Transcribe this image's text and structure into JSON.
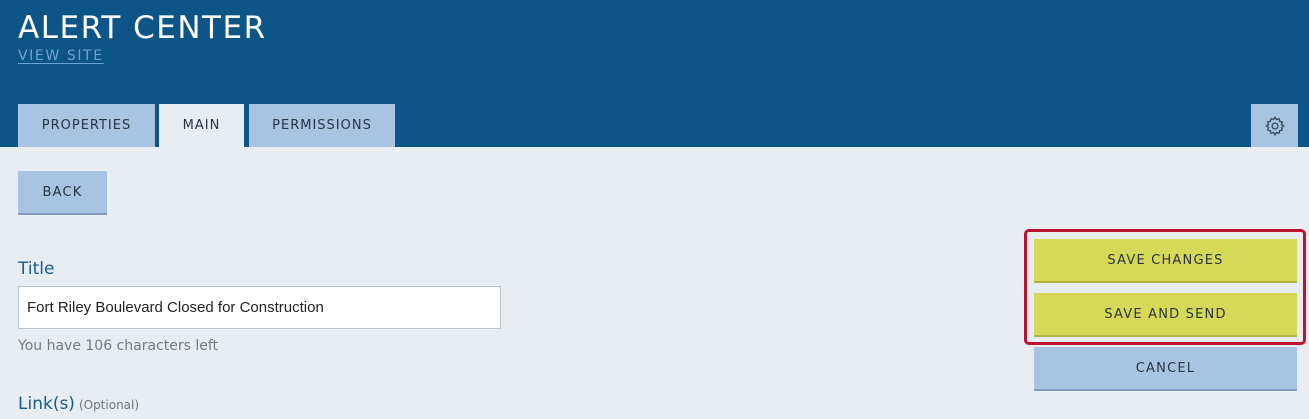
{
  "header": {
    "title": "ALERT CENTER",
    "view_site_link": "VIEW SITE"
  },
  "tabs": [
    {
      "label": "PROPERTIES",
      "active": false
    },
    {
      "label": "MAIN",
      "active": true
    },
    {
      "label": "PERMISSIONS",
      "active": false
    }
  ],
  "settings_icon": "gear-icon",
  "actions": {
    "back": "BACK",
    "save_changes": "SAVE CHANGES",
    "save_and_send": "SAVE AND SEND",
    "cancel": "CANCEL"
  },
  "form": {
    "title_label": "Title",
    "title_value": "Fort Riley Boulevard Closed for Construction",
    "chars_left_text": "You have 106 characters left",
    "links_label": "Link(s)",
    "links_optional": "(Optional)"
  },
  "colors": {
    "header_bg": "#0d5487",
    "tab_bg": "#a8c4e2",
    "primary_button": "#d6d858",
    "highlight": "#c0122c",
    "page_bg": "#e8edf1"
  }
}
